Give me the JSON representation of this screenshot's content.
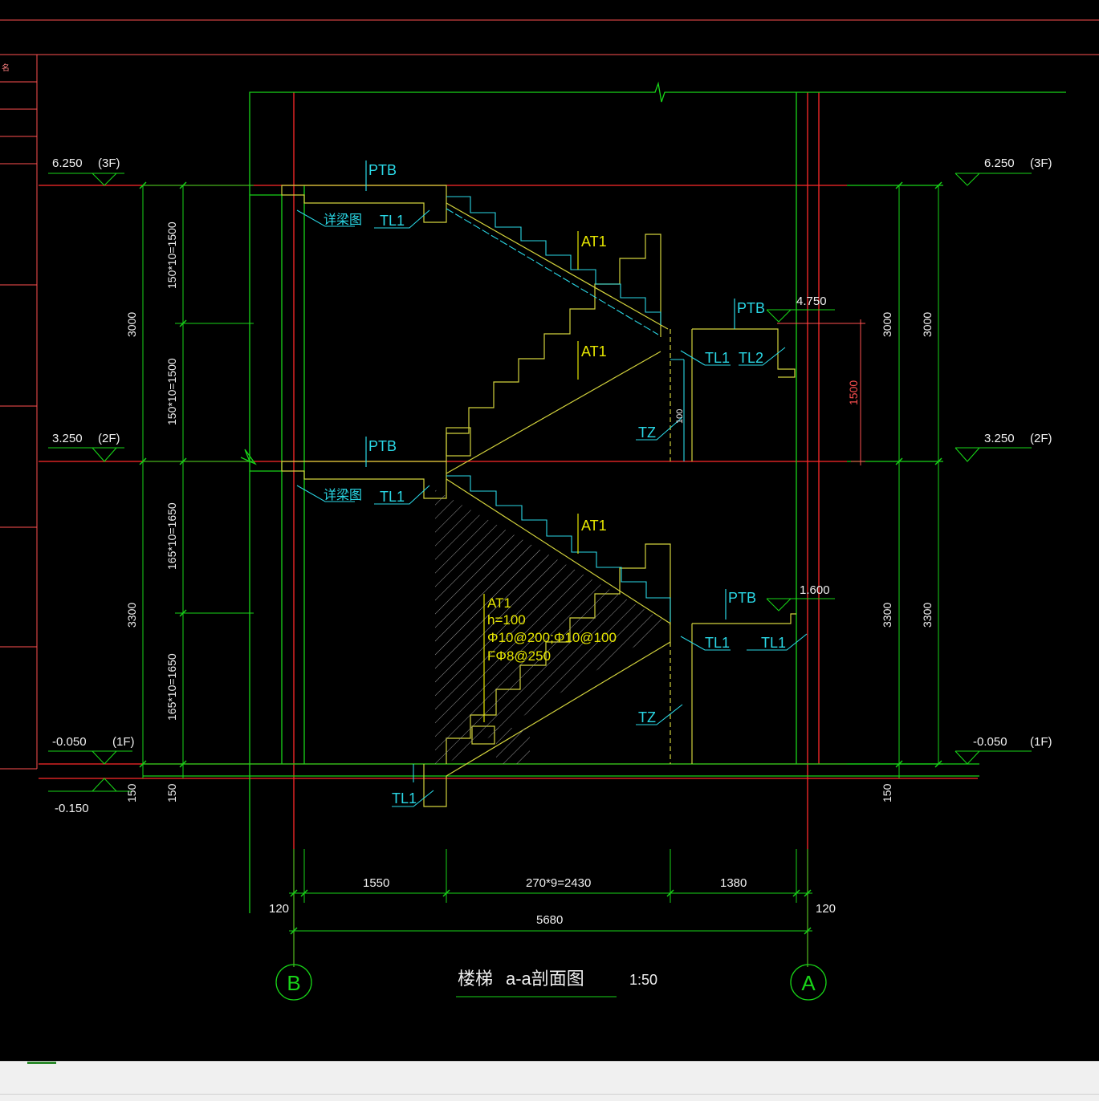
{
  "drawing": {
    "title_cn": "楼梯",
    "title_section": "a-a剖面图",
    "scale": "1:50"
  },
  "colors": {
    "background": "#000000",
    "frame_red": "#ff5050",
    "grid_red": "#ff2a2a",
    "line_green": "#18d418",
    "stair_yellow": "#d2d23c",
    "label_cyan": "#2ad8e6",
    "label_yellow": "#e6e600",
    "text_white": "#f0f0f0"
  },
  "axes": {
    "left": "B",
    "right": "A"
  },
  "levels": {
    "left": [
      {
        "value": "6.250",
        "floor": "(3F)"
      },
      {
        "value": "3.250",
        "floor": "(2F)"
      },
      {
        "value": "-0.050",
        "floor": "(1F)"
      },
      {
        "value": "-0.150",
        "floor": ""
      }
    ],
    "right": [
      {
        "value": "6.250",
        "floor": "(3F)"
      },
      {
        "value": "3.250",
        "floor": "(2F)"
      },
      {
        "value": "-0.050",
        "floor": "(1F)"
      }
    ],
    "landings": [
      "4.750",
      "1.600"
    ]
  },
  "dims": {
    "left_outer": [
      "3000",
      "3300",
      "150"
    ],
    "left_inner": [
      "150*10=1500",
      "150*10=1500",
      "165*10=1650",
      "165*10=1650",
      "150"
    ],
    "right_inner": [
      "3000",
      "3300",
      "150"
    ],
    "right_outer": [
      "3000",
      "3300"
    ],
    "bottom_row1": [
      "1550",
      "270*9=2430",
      "1380"
    ],
    "bottom_row2": [
      "120",
      "5680",
      "120"
    ],
    "red_1500": "1500",
    "tz_100": "100"
  },
  "labels": {
    "ptb": "PTB",
    "at1": "AT1",
    "tl1": "TL1",
    "tl2": "TL2",
    "tz": "TZ",
    "detail_beam": "详梁图"
  },
  "at1_note": [
    "AT1",
    "h=100",
    "Φ10@200;Φ10@100",
    "FΦ8@250"
  ],
  "sidebar_char": "名"
}
